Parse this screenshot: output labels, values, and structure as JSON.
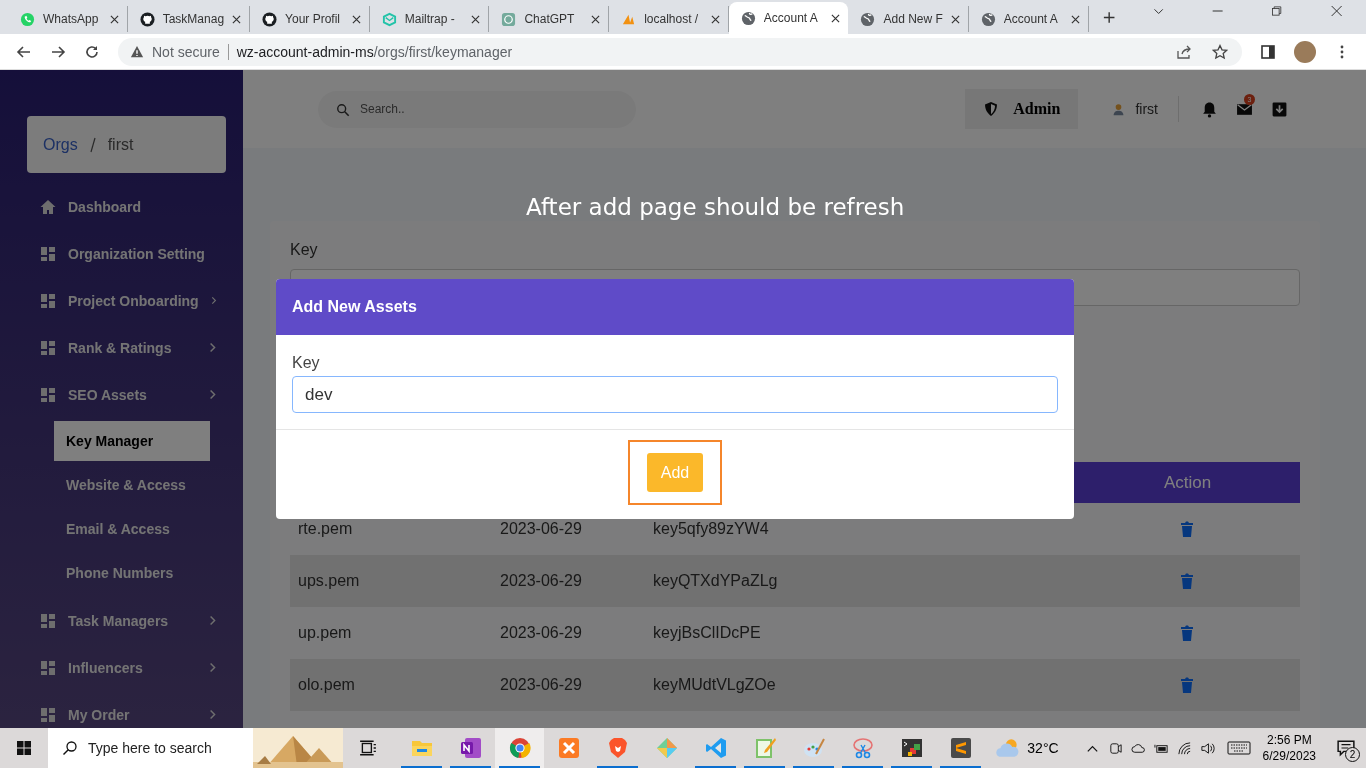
{
  "browser": {
    "tabs": [
      {
        "title": "WhatsApp",
        "kind": "whatsapp",
        "selected": false
      },
      {
        "title": "TaskManag",
        "kind": "github",
        "selected": false
      },
      {
        "title": "Your Profil",
        "kind": "github",
        "selected": false
      },
      {
        "title": "Mailtrap -",
        "kind": "mailtrap",
        "selected": false
      },
      {
        "title": "ChatGPT",
        "kind": "chatgpt",
        "selected": false
      },
      {
        "title": "localhost /",
        "kind": "pma",
        "selected": false
      },
      {
        "title": "Account A",
        "kind": "globe",
        "selected": true
      },
      {
        "title": "Add New F",
        "kind": "globe",
        "selected": false
      },
      {
        "title": "Account A",
        "kind": "globe",
        "selected": false
      }
    ],
    "address": {
      "security": "Not secure",
      "host": "wz-account-admin-ms",
      "path": "/orgs/first/keymanager"
    }
  },
  "breadcrumb": [
    {
      "label": "Orgs",
      "kind": "link"
    },
    {
      "label": "first",
      "kind": "current"
    }
  ],
  "sidebar": {
    "items": [
      {
        "label": "Dashboard",
        "kind": "link",
        "selected": false
      },
      {
        "label": "Organization Setting",
        "kind": "group",
        "selected": false
      },
      {
        "label": "Project Onboarding",
        "kind": "group",
        "selected": false
      },
      {
        "label": "Rank & Ratings",
        "kind": "group",
        "selected": false
      },
      {
        "label": "SEO Assets",
        "kind": "group",
        "selected": false,
        "children": [
          {
            "label": "Key Manager",
            "selected": true
          },
          {
            "label": "Website & Access",
            "selected": false
          },
          {
            "label": "Email & Access",
            "selected": false
          },
          {
            "label": "Phone Numbers",
            "selected": false
          }
        ]
      },
      {
        "label": "Task Managers",
        "kind": "group",
        "selected": false
      },
      {
        "label": "Influencers",
        "kind": "group",
        "selected": false
      },
      {
        "label": "My Order",
        "kind": "group",
        "selected": false
      }
    ]
  },
  "header": {
    "search": {
      "placeholder": "Search.."
    },
    "role": "Admin",
    "user": "first",
    "mail_count": "3"
  },
  "annotation": "After add page should be refresh",
  "form": {
    "label": "Key"
  },
  "table": {
    "columns": [
      "Action"
    ],
    "rows": [
      {
        "name": "rte.pem",
        "date": "2023-06-29",
        "key": "key5qfy89zYW4"
      },
      {
        "name": "ups.pem",
        "date": "2023-06-29",
        "key": "keyQTXdYPaZLg"
      },
      {
        "name": "up.pem",
        "date": "2023-06-29",
        "key": "keyjBsClIDcPE"
      },
      {
        "name": "olo.pem",
        "date": "2023-06-29",
        "key": "keyMUdtVLgZOe"
      }
    ]
  },
  "modal": {
    "title": "Add New Assets",
    "field_label": "Key",
    "value": "dev",
    "button": "Add",
    "highlighted": true
  },
  "taskbar": {
    "search": {
      "placeholder": "Type here to search"
    },
    "apps": [
      {
        "kind": "explorer",
        "running": true,
        "active": false
      },
      {
        "kind": "onenote",
        "running": true,
        "active": false
      },
      {
        "kind": "chrome",
        "running": true,
        "active": true
      },
      {
        "kind": "xampp",
        "running": false,
        "active": false
      },
      {
        "kind": "brave",
        "running": true,
        "active": false
      },
      {
        "kind": "git",
        "running": false,
        "active": false
      },
      {
        "kind": "vscode",
        "running": true,
        "active": false
      },
      {
        "kind": "notepad",
        "running": true,
        "active": false
      },
      {
        "kind": "paint",
        "running": true,
        "active": false
      },
      {
        "kind": "snipping",
        "running": true,
        "active": false
      },
      {
        "kind": "terminal",
        "running": true,
        "active": false
      },
      {
        "kind": "sublime",
        "running": true,
        "active": false
      }
    ],
    "weather": "32°C",
    "time": "2:56 PM",
    "date": "6/29/2023",
    "notifications": "2"
  }
}
